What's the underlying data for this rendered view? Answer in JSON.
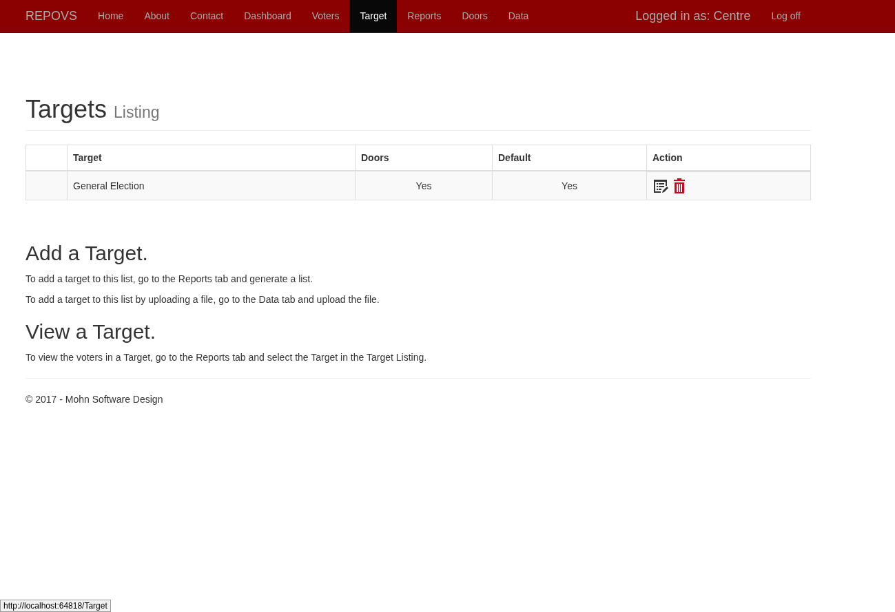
{
  "navbar": {
    "brand": "REPOVS",
    "items": [
      {
        "label": "Home",
        "selected": false
      },
      {
        "label": "About",
        "selected": false
      },
      {
        "label": "Contact",
        "selected": false
      },
      {
        "label": "Dashboard",
        "selected": false
      },
      {
        "label": "Voters",
        "selected": false
      },
      {
        "label": "Target",
        "selected": true
      },
      {
        "label": "Reports",
        "selected": false
      },
      {
        "label": "Doors",
        "selected": false
      },
      {
        "label": "Data",
        "selected": false
      }
    ],
    "user": "Logged in as: Centre",
    "logoff": "Log off"
  },
  "page_header": {
    "title": "Targets",
    "subtitle": "Listing"
  },
  "table": {
    "columns": [
      "Target",
      "Doors",
      "Default",
      "Action"
    ],
    "rows": [
      {
        "target": "General Election",
        "doors": "Yes",
        "default": "Yes"
      }
    ]
  },
  "sections": [
    {
      "heading": "Add a Target.",
      "paragraphs": [
        "To add a target to this list, go to the Reports tab and generate a list.",
        "To add a target to this list by uploading a file, go to the Data tab and upload the file."
      ]
    },
    {
      "heading": "View a Target.",
      "paragraphs": [
        "To view the voters in a Target, go to the Reports tab and select the Target in the Target Listing."
      ]
    }
  ],
  "footer": "© 2017 - Mohn Software Design",
  "status_url": "http://localhost:64818/Target"
}
